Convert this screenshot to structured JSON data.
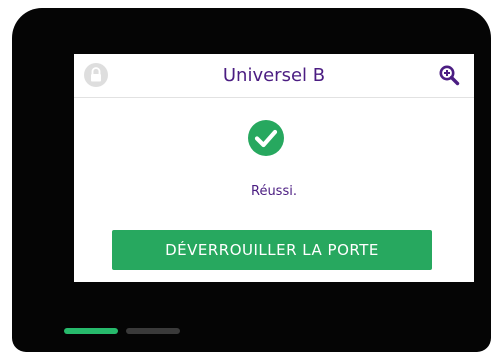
{
  "header": {
    "title": "Universel B",
    "lock_icon": "lock-icon",
    "search_icon": "search-plus-icon"
  },
  "status": {
    "icon": "check-circle-icon",
    "message": "Réussi."
  },
  "actions": {
    "unlock_label": "DÉVERROUILLER LA PORTE"
  },
  "page_indicator": {
    "pages": 2,
    "active_index": 0
  },
  "colors": {
    "accent_purple": "#4b1d82",
    "success_green": "#27a85f",
    "indicator_active": "#27ba6c",
    "indicator_inactive": "#3a3a3a"
  }
}
